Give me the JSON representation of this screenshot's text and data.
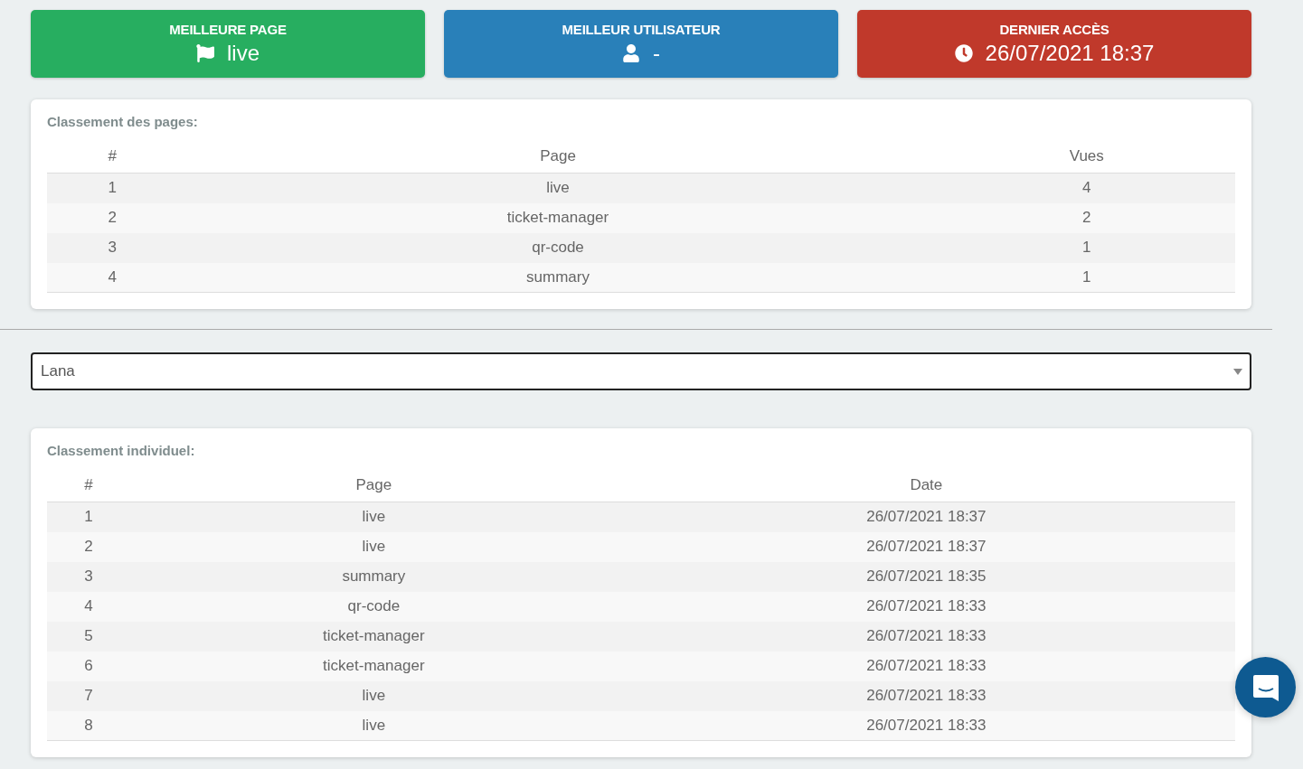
{
  "stat_cards": [
    {
      "kind": "page",
      "color": "#27ae60",
      "title": "MEILLEURE PAGE",
      "value": "live"
    },
    {
      "kind": "user",
      "color": "#2980b9",
      "title": "MEILLEUR UTILISATEUR",
      "value": "-"
    },
    {
      "kind": "time",
      "color": "#c0392b",
      "title": "DERNIER ACCÈS",
      "value": "26/07/2021 18:37"
    }
  ],
  "pages_ranking": {
    "title": "Classement des pages:",
    "columns": [
      "#",
      "Page",
      "Vues"
    ],
    "rows": [
      [
        "1",
        "live",
        "4"
      ],
      [
        "2",
        "ticket-manager",
        "2"
      ],
      [
        "3",
        "qr-code",
        "1"
      ],
      [
        "4",
        "summary",
        "1"
      ]
    ]
  },
  "user_select": {
    "value": "Lana"
  },
  "individual_ranking": {
    "title": "Classement individuel:",
    "columns": [
      "#",
      "Page",
      "Date"
    ],
    "rows": [
      [
        "1",
        "live",
        "26/07/2021 18:37"
      ],
      [
        "2",
        "live",
        "26/07/2021 18:37"
      ],
      [
        "3",
        "summary",
        "26/07/2021 18:35"
      ],
      [
        "4",
        "qr-code",
        "26/07/2021 18:33"
      ],
      [
        "5",
        "ticket-manager",
        "26/07/2021 18:33"
      ],
      [
        "6",
        "ticket-manager",
        "26/07/2021 18:33"
      ],
      [
        "7",
        "live",
        "26/07/2021 18:33"
      ],
      [
        "8",
        "live",
        "26/07/2021 18:33"
      ]
    ]
  }
}
